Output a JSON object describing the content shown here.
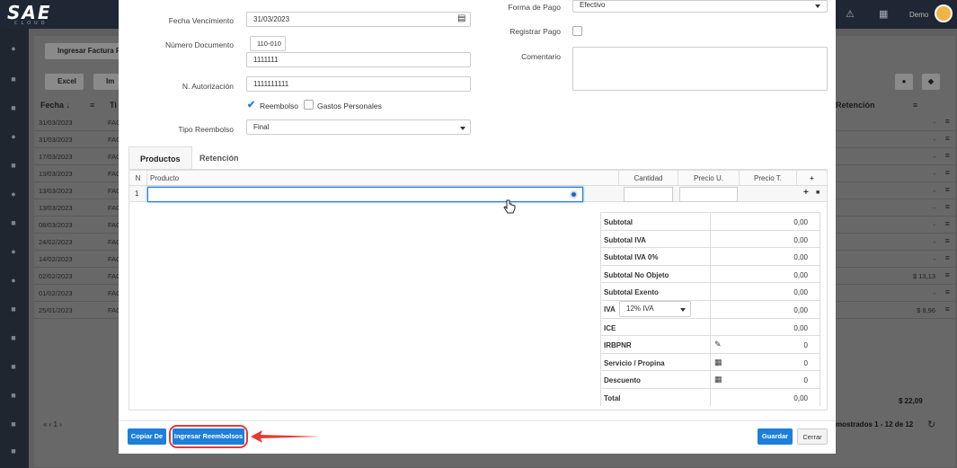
{
  "app": {
    "logo": "SAE",
    "logo_sub": "CLOUD",
    "user": "Demo"
  },
  "background": {
    "button_ingresar": "Ingresar Factura P",
    "button_excel": "Excel",
    "button_im": "Im",
    "col_fecha": "Fecha ↓",
    "col_ti": "Ti",
    "col_retencion": "Retención",
    "rows": [
      {
        "date": "31/03/2023",
        "fac": "FAC",
        "value": "-"
      },
      {
        "date": "31/03/2023",
        "fac": "FAC",
        "value": "-"
      },
      {
        "date": "17/03/2023",
        "fac": "FAC",
        "value": "-"
      },
      {
        "date": "13/03/2023",
        "fac": "FAC",
        "value": "-"
      },
      {
        "date": "13/03/2023",
        "fac": "FAC",
        "value": "-"
      },
      {
        "date": "13/03/2023",
        "fac": "FAC",
        "value": "-"
      },
      {
        "date": "08/03/2023",
        "fac": "FAC",
        "value": "-"
      },
      {
        "date": "24/02/2023",
        "fac": "FAC",
        "value": "-"
      },
      {
        "date": "14/02/2023",
        "fac": "FAC",
        "value": "-"
      },
      {
        "date": "02/02/2023",
        "fac": "FAC",
        "value": "$ 13,13"
      },
      {
        "date": "01/02/2023",
        "fac": "FAC",
        "value": "-"
      },
      {
        "date": "25/01/2023",
        "fac": "FAC",
        "value": "$ 8,96"
      }
    ],
    "total": "$ 22,09",
    "footer": "mostrados 1 - 12 de 12",
    "pagination": "«  ‹  1  ›"
  },
  "form": {
    "fecha_venc_label": "Fecha Vencimiento",
    "fecha_venc_value": "31/03/2023",
    "num_doc_label": "Número Documento",
    "num_doc_prefix": "110-010",
    "num_doc_value": "1111111",
    "autorizacion_label": "N. Autorización",
    "autorizacion_value": "1111111111",
    "reembolso_label": "Reembolso",
    "gastos_label": "Gastos Personales",
    "tipo_label": "Tipo Reembolso",
    "tipo_value": "Final",
    "forma_pago_label": "Forma de Pago",
    "forma_pago_value": "Efectivo",
    "registrar_label": "Registrar Pago",
    "comentario_label": "Comentario"
  },
  "tabs": [
    "Productos",
    "Retención"
  ],
  "grid": {
    "col_n": "N",
    "col_producto": "Producto",
    "col_cantidad": "Cantidad",
    "col_precio_u": "Precio U.",
    "col_precio_t": "Precio T.",
    "add": "+",
    "row_num": "1"
  },
  "totals": [
    {
      "label": "Subtotal",
      "value": "0,00"
    },
    {
      "label": "Subtotal IVA",
      "value": "0,00"
    },
    {
      "label": "Subtotal IVA 0%",
      "value": "0,00"
    },
    {
      "label": "Subtotal No Objeto",
      "value": "0,00"
    },
    {
      "label": "Subtotal Exento",
      "value": "0,00"
    },
    {
      "label": "IVA",
      "value": "0,00",
      "select": "12% IVA"
    },
    {
      "label": "ICE",
      "value": "0,00"
    },
    {
      "label": "IRBPNR",
      "value": "0"
    },
    {
      "label": "Servicio / Propina",
      "value": "0"
    },
    {
      "label": "Descuento",
      "value": "0"
    },
    {
      "label": "Total",
      "value": "0,00"
    }
  ],
  "footer": {
    "copiar": "Copiar De",
    "ingresar_reembolsos": "Ingresar Reembolsos",
    "guardar": "Guardar",
    "cerrar": "Cerrar"
  },
  "colors": {
    "primary": "#1d7fd9",
    "highlight": "#e53935",
    "check": "#1d7fd9"
  }
}
